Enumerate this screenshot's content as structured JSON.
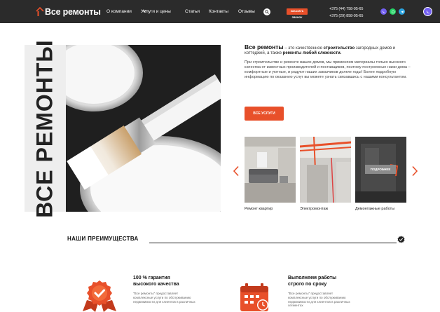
{
  "header": {
    "logo": {
      "brand": "Все",
      "brand_sub": "ремонты"
    },
    "nav": [
      "О компании",
      "Услуги и цены",
      "Статьи",
      "Контакты",
      "Отзывы"
    ],
    "call_button": "ЗАКАЗАТЬ ЗВОНОК",
    "phones": [
      "+375 (44) 758-95-65",
      "+375 (29) 858-95-65"
    ]
  },
  "hero": {
    "vertical_title": "ВСЕ РЕМОНТЫ",
    "intro_brand": "Все ремонты",
    "intro_p1_a": " – это качественное ",
    "intro_p1_b": "строительство",
    "intro_p1_c": " загородных домов и коттеджей, а также ",
    "intro_p1_d": "ремонты любой сложности.",
    "intro_p2": "При строительстве и ремонте ваших домов, мы применяем материалы только высокого качества от известных производителей и поставщиков, поэтому построенные нами дома – комфортные и уютные, и радуют наших заказчиков долгие годы! Более подробную информацию по оказанию услуг вы можете узнать связавшись с нашими консультантом.",
    "services_button": "ВСЕ УСЛУГИ"
  },
  "carousel": {
    "items": [
      {
        "caption": "Ремонт квартир"
      },
      {
        "caption": "Электромонтаж"
      },
      {
        "caption": "Демонтажные работы",
        "button": "ПОДРОБНЕЕ"
      }
    ]
  },
  "advantages": {
    "title": "НАШИ ПРЕИМУЩЕСТВА",
    "features": [
      {
        "title_1": "100 % гарантия",
        "title_2": "высокого качества",
        "text": "\"Все ремонты\" предоставляет комплексные услуги по обслуживанию недвижимости для клиентов в различных"
      },
      {
        "title_1": "Выполняем работы",
        "title_2": "строго по сроку",
        "text": "\"Все ремонты\" предоставляет комплексные услуги по обслуживанию недвижимости для клиентов в различных сегментах"
      }
    ]
  },
  "colors": {
    "accent": "#e8502a",
    "header_bg": "#2b2b2b",
    "text": "#222222"
  }
}
